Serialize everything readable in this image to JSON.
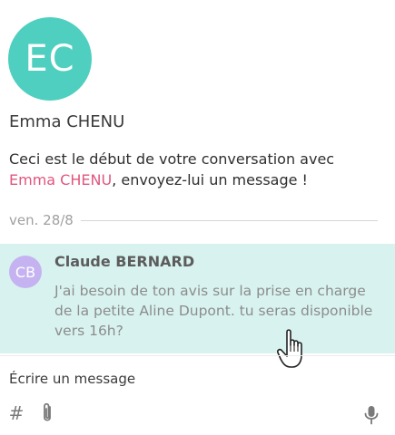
{
  "contact": {
    "initials": "EC",
    "name": "Emma CHENU",
    "avatar_color": "#4fcfbf"
  },
  "intro": {
    "prefix": "Ceci est le début de votre conversation avec ",
    "link": "Emma CHENU",
    "suffix": ", envoyez-lui un message !",
    "link_color": "#e0567e"
  },
  "date_separator": {
    "label": "ven. 28/8"
  },
  "messages": [
    {
      "initials": "CB",
      "sender": "Claude BERNARD",
      "text": "J'ai besoin de ton avis sur la prise en charge de la petite Aline Dupont. tu seras disponible vers 16h?",
      "avatar_color": "#c5b3f1",
      "highlight_color": "#d8f3ef"
    }
  ],
  "composer": {
    "placeholder": "Écrire un message",
    "hash_symbol": "#",
    "icons": [
      "hash-icon",
      "paperclip-icon",
      "microphone-icon"
    ]
  }
}
